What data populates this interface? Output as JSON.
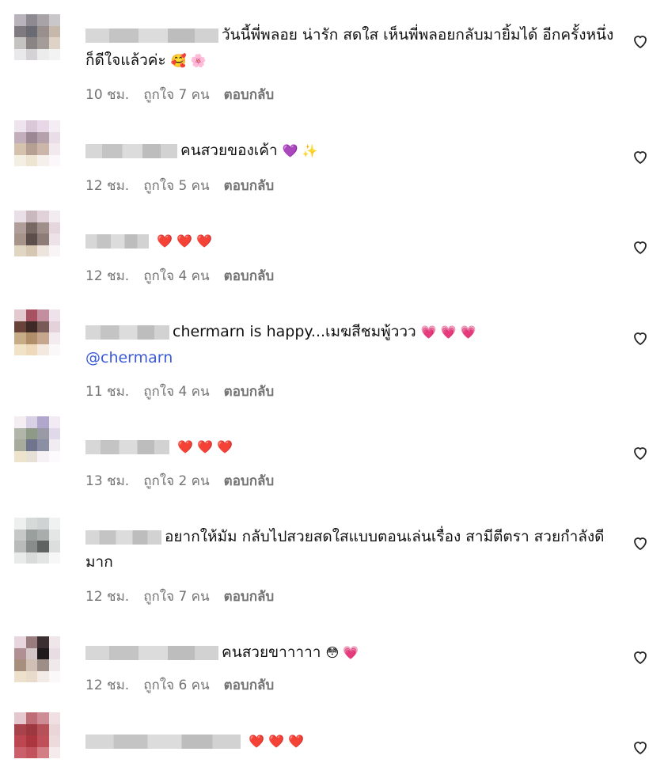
{
  "comments": [
    {
      "text": "วันนี้พี่พลอย น่ารัก สดใส เห็นพี่พลอยกลับมายิ้มได้ อีกครั้งหนึ่ง ก็ดีใจแล้วค่ะ",
      "emoji": "🥰 🌸",
      "mention": "",
      "time": "10 ชม.",
      "likes": "ถูกใจ 7 คน",
      "reply": "ตอบกลับ"
    },
    {
      "text": "คนสวยของเค้า",
      "emoji": "💜 ✨",
      "mention": "",
      "time": "12 ชม.",
      "likes": "ถูกใจ 5 คน",
      "reply": "ตอบกลับ"
    },
    {
      "text": "",
      "emoji": "❤️ ❤️ ❤️",
      "mention": "",
      "time": "12 ชม.",
      "likes": "ถูกใจ 4 คน",
      "reply": "ตอบกลับ"
    },
    {
      "text": "chermarn is happy...เมฆสีชมพู้ววว",
      "emoji": "💗 💗 💗",
      "mention": "@chermarn",
      "time": "11 ชม.",
      "likes": "ถูกใจ 4 คน",
      "reply": "ตอบกลับ"
    },
    {
      "text": "",
      "emoji": "❤️ ❤️ ❤️",
      "mention": "",
      "time": "13 ชม.",
      "likes": "ถูกใจ 2 คน",
      "reply": "ตอบกลับ"
    },
    {
      "text": "อยากให้มัม กลับไปสวยสดใสแบบตอนเล่นเรื่อง สามีตีตรา สวยกำลังดีมาก",
      "emoji": "",
      "mention": "",
      "time": "12 ชม.",
      "likes": "ถูกใจ 7 คน",
      "reply": "ตอบกลับ"
    },
    {
      "text": "คนสวยขาาาาา",
      "emoji": "😳 💗",
      "mention": "",
      "time": "12 ชม.",
      "likes": "ถูกใจ 6 คน",
      "reply": "ตอบกลับ"
    },
    {
      "text": "",
      "emoji": "❤️ ❤️ ❤️",
      "mention": "",
      "time": "",
      "likes": "",
      "reply": ""
    }
  ]
}
